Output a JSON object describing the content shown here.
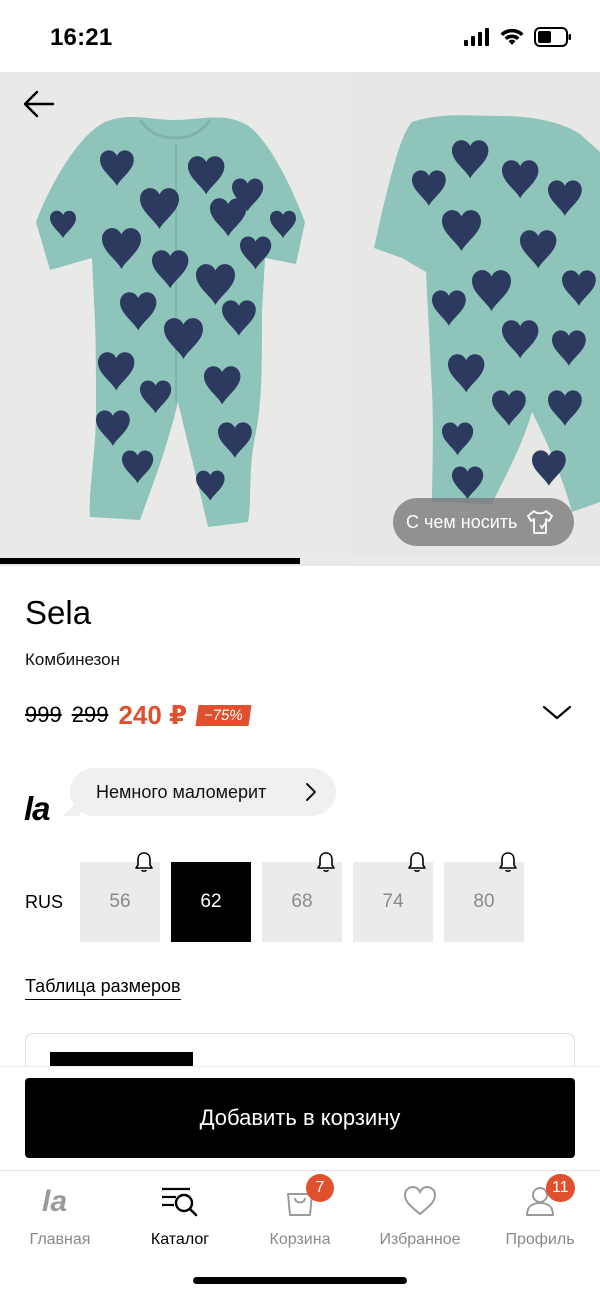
{
  "status_bar": {
    "time": "16:21"
  },
  "gallery": {
    "look_button_label": "С чем носить",
    "progress_fraction": 0.5
  },
  "product": {
    "brand": "Sela",
    "type": "Комбинезон",
    "old_price_1": "999",
    "old_price_2": "299",
    "price": "240 ₽",
    "discount": "−75%"
  },
  "fit": {
    "logo": "la",
    "text": "Немного маломерит"
  },
  "sizes": {
    "system": "RUS",
    "items": [
      {
        "label": "56",
        "selected": false,
        "notify": true
      },
      {
        "label": "62",
        "selected": true,
        "notify": false
      },
      {
        "label": "68",
        "selected": false,
        "notify": true
      },
      {
        "label": "74",
        "selected": false,
        "notify": true
      },
      {
        "label": "80",
        "selected": false,
        "notify": true
      }
    ],
    "table_link": "Таблица размеров"
  },
  "cta": {
    "label": "Добавить в корзину"
  },
  "tabbar": {
    "items": [
      {
        "label": "Главная",
        "icon": "la-logo-icon",
        "active": false
      },
      {
        "label": "Каталог",
        "icon": "catalog-search-icon",
        "active": true
      },
      {
        "label": "Корзина",
        "icon": "bag-icon",
        "active": false,
        "badge": "7"
      },
      {
        "label": "Избранное",
        "icon": "heart-icon",
        "active": false
      },
      {
        "label": "Профиль",
        "icon": "profile-icon",
        "active": false,
        "badge": "11"
      }
    ]
  },
  "colors": {
    "accent": "#e0502e",
    "garment": "#8fc4bb",
    "hearts": "#2b3a5e"
  }
}
